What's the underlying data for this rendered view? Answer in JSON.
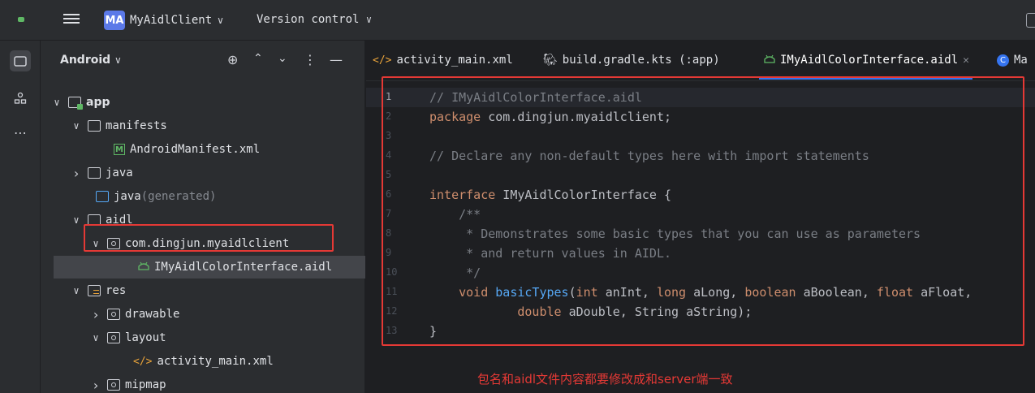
{
  "toolbar": {
    "project_badge": "MA",
    "project_name": "MyAidlClient",
    "vcs_label": "Version control",
    "chevron": "∨"
  },
  "project_panel": {
    "view_label": "Android",
    "tree": [
      {
        "label": "app",
        "arrow": "∨",
        "icon": "module-folder-icon"
      },
      {
        "label": "manifests",
        "arrow": "∨",
        "icon": "folder-icon"
      },
      {
        "label": "AndroidManifest.xml",
        "arrow": "",
        "icon": "manifest-icon"
      },
      {
        "label": "java",
        "arrow": "›",
        "icon": "folder-icon"
      },
      {
        "label": "java",
        "suffix": " (generated)",
        "arrow": "",
        "icon": "generated-folder-icon"
      },
      {
        "label": "aidl",
        "arrow": "∨",
        "icon": "folder-icon"
      },
      {
        "label": "com.dingjun.myaidlclient",
        "arrow": "∨",
        "icon": "package-icon"
      },
      {
        "label": "IMyAidlColorInterface.aidl",
        "arrow": "",
        "icon": "android-icon"
      },
      {
        "label": "res",
        "arrow": "∨",
        "icon": "resource-folder-icon"
      },
      {
        "label": "drawable",
        "arrow": "›",
        "icon": "package-icon"
      },
      {
        "label": "layout",
        "arrow": "∨",
        "icon": "package-icon"
      },
      {
        "label": "activity_main.xml",
        "arrow": "",
        "icon": "xml-icon"
      },
      {
        "label": "mipmap",
        "arrow": "›",
        "icon": "package-icon"
      }
    ]
  },
  "tabs": [
    {
      "label": "activity_main.xml",
      "icon": "xml-icon"
    },
    {
      "label": "build.gradle.kts (:app)",
      "icon": "gradle-icon"
    },
    {
      "label": "IMyAidlColorInterface.aidl",
      "icon": "android-icon",
      "active": true
    },
    {
      "label": "Ma",
      "icon": "class-icon"
    }
  ],
  "editor": {
    "line_numbers": [
      "1",
      "2",
      "3",
      "4",
      "5",
      "6",
      "7",
      "8",
      "9",
      "10",
      "11",
      "12",
      "13"
    ],
    "lines": {
      "l1": "// IMyAidlColorInterface.aidl",
      "l2a": "package",
      "l2b": " com.dingjun.myaidlclient;",
      "l4": "// Declare any non-default types here with import statements",
      "l6a": "interface",
      "l6b": " IMyAidlColorInterface {",
      "l7": "    /**",
      "l8": "     * Demonstrates some basic types that you can use as parameters",
      "l9": "     * and return values in AIDL.",
      "l10": "     */",
      "l11a": "    void",
      "l11b": "basicTypes",
      "l11c": "(",
      "l11d": "int",
      "l11e": " anInt, ",
      "l11f": "long",
      "l11g": " aLong, ",
      "l11h": "boolean",
      "l11i": " aBoolean, ",
      "l11j": "float",
      "l11k": " aFloat,",
      "l12a": "            double",
      "l12b": " aDouble, String aString);",
      "l13": "}"
    }
  },
  "annotation": "包名和aidl文件内容都要修改成和server端一致",
  "colors": {
    "highlight_box": "#e53935",
    "accent": "#3574f0"
  }
}
